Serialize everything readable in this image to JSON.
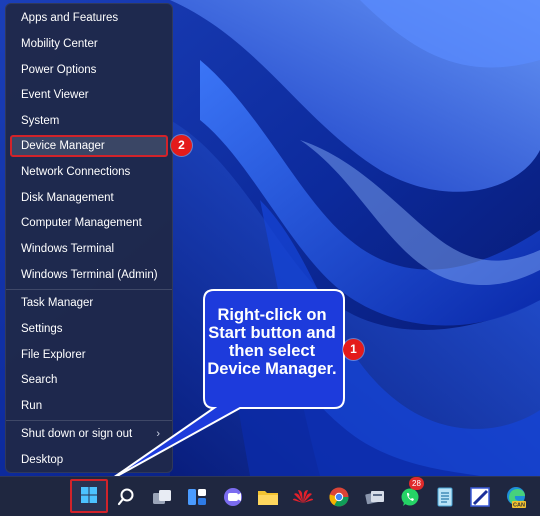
{
  "menu": {
    "items": [
      {
        "label": "Apps and Features"
      },
      {
        "label": "Mobility Center"
      },
      {
        "label": "Power Options"
      },
      {
        "label": "Event Viewer"
      },
      {
        "label": "System"
      },
      {
        "label": "Device Manager",
        "highlighted": true
      },
      {
        "label": "Network Connections"
      },
      {
        "label": "Disk Management"
      },
      {
        "label": "Computer Management"
      },
      {
        "label": "Windows Terminal"
      },
      {
        "label": "Windows Terminal (Admin)"
      },
      {
        "label": "Task Manager"
      },
      {
        "label": "Settings"
      },
      {
        "label": "File Explorer"
      },
      {
        "label": "Search"
      },
      {
        "label": "Run"
      },
      {
        "label": "Shut down or sign out",
        "submenu": true
      },
      {
        "label": "Desktop"
      }
    ]
  },
  "annotation": {
    "step1": "1",
    "step2": "2",
    "callout_lines": [
      "Right-click on",
      "Start button and",
      "then select",
      "Device Manager."
    ]
  },
  "taskbar": {
    "icons": [
      "windows-start-icon",
      "search-icon",
      "task-view-icon",
      "widgets-icon",
      "teams-chat-icon",
      "file-explorer-icon",
      "huawei-icon",
      "chrome-icon",
      "app-icon",
      "whatsapp-icon",
      "notepad-icon",
      "paint-icon",
      "edge-can-icon"
    ],
    "whatsapp_badge": "28",
    "edge_label": "CAN"
  },
  "colors": {
    "accent": "#d2232a",
    "menu_bg": "#1f294a",
    "taskbar_bg": "#1f2740"
  }
}
